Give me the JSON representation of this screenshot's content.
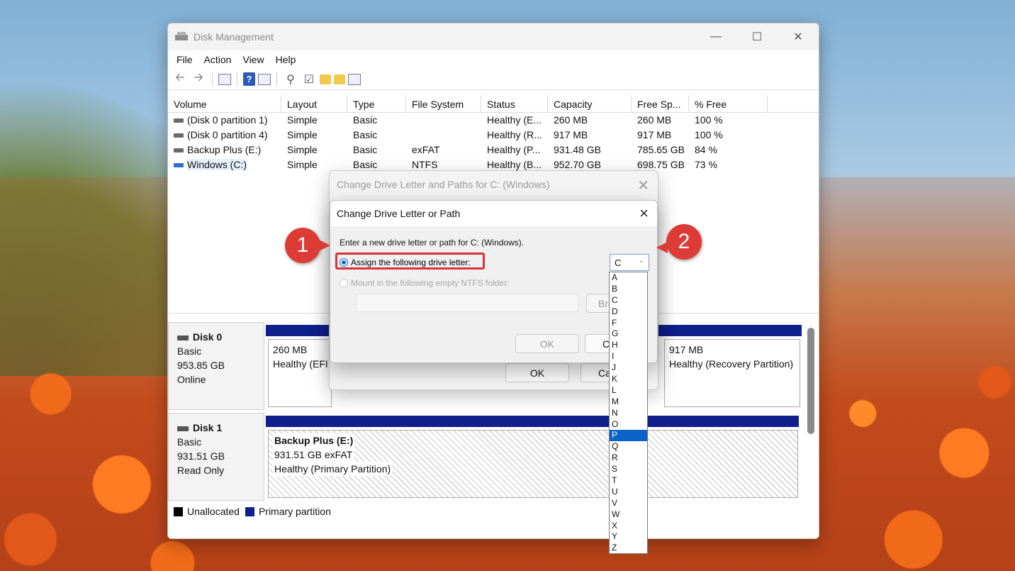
{
  "window": {
    "title": "Disk Management",
    "controls": {
      "minimize": "—",
      "maximize": "☐",
      "close": "✕"
    }
  },
  "menu": [
    "File",
    "Action",
    "View",
    "Help"
  ],
  "toolbar_icons": [
    "back-arrow-icon",
    "forward-arrow-icon",
    "console-icon",
    "help-icon",
    "properties-icon",
    "connect-icon",
    "checklist-icon",
    "folder-up-icon",
    "folder-search-icon",
    "view-list-icon"
  ],
  "volume_table": {
    "headers": [
      "Volume",
      "Layout",
      "Type",
      "File System",
      "Status",
      "Capacity",
      "Free Sp...",
      "% Free",
      ""
    ],
    "rows": [
      [
        "(Disk 0 partition 1)",
        "Simple",
        "Basic",
        "",
        "Healthy (E...",
        "260 MB",
        "260 MB",
        "100 %"
      ],
      [
        "(Disk 0 partition 4)",
        "Simple",
        "Basic",
        "",
        "Healthy (R...",
        "917 MB",
        "917 MB",
        "100 %"
      ],
      [
        "Backup Plus (E:)",
        "Simple",
        "Basic",
        "exFAT",
        "Healthy (P...",
        "931.48 GB",
        "785.65 GB",
        "84 %"
      ],
      [
        "Windows (C:)",
        "Simple",
        "Basic",
        "NTFS",
        "Healthy (B...",
        "952.70 GB",
        "698.75 GB",
        "73 %"
      ]
    ]
  },
  "disks": [
    {
      "name": "Disk 0",
      "type": "Basic",
      "size": "953.85 GB",
      "state": "Online",
      "partitions": [
        {
          "line1": "260 MB",
          "line2": "Healthy (EFI"
        },
        {
          "line1": "917 MB",
          "line2": "Healthy (Recovery Partition)"
        }
      ]
    },
    {
      "name": "Disk 1",
      "type": "Basic",
      "size": "931.51 GB",
      "state": "Read Only",
      "partitions": [
        {
          "line1": "Backup Plus  (E:)",
          "line2": "931.51 GB exFAT",
          "line3": "Healthy (Primary Partition)"
        }
      ]
    }
  ],
  "legend": [
    {
      "label": "Unallocated",
      "color": "#000000"
    },
    {
      "label": "Primary partition",
      "color": "#0f1f8c"
    }
  ],
  "back_dialog": {
    "title": "Change Drive Letter and Paths for C: (Windows)",
    "ok_label": "OK",
    "cancel_label": "Ca"
  },
  "front_dialog": {
    "title": "Change Drive Letter or Path",
    "prompt": "Enter a new drive letter or path for C: (Windows).",
    "option_assign": "Assign the following drive letter:",
    "option_mount": "Mount in the following empty NTFS folder:",
    "browse_label": "Bro",
    "ok_label": "OK",
    "cancel_label": "C",
    "selected_letter": "C",
    "letters": [
      "A",
      "B",
      "C",
      "D",
      "F",
      "G",
      "H",
      "I",
      "J",
      "K",
      "L",
      "M",
      "N",
      "O",
      "P",
      "Q",
      "R",
      "S",
      "T",
      "U",
      "V",
      "W",
      "X",
      "Y",
      "Z"
    ],
    "highlighted_letter": "P"
  },
  "annotations": {
    "step1": "1",
    "step2": "2",
    "accent": "#dd3b35"
  }
}
